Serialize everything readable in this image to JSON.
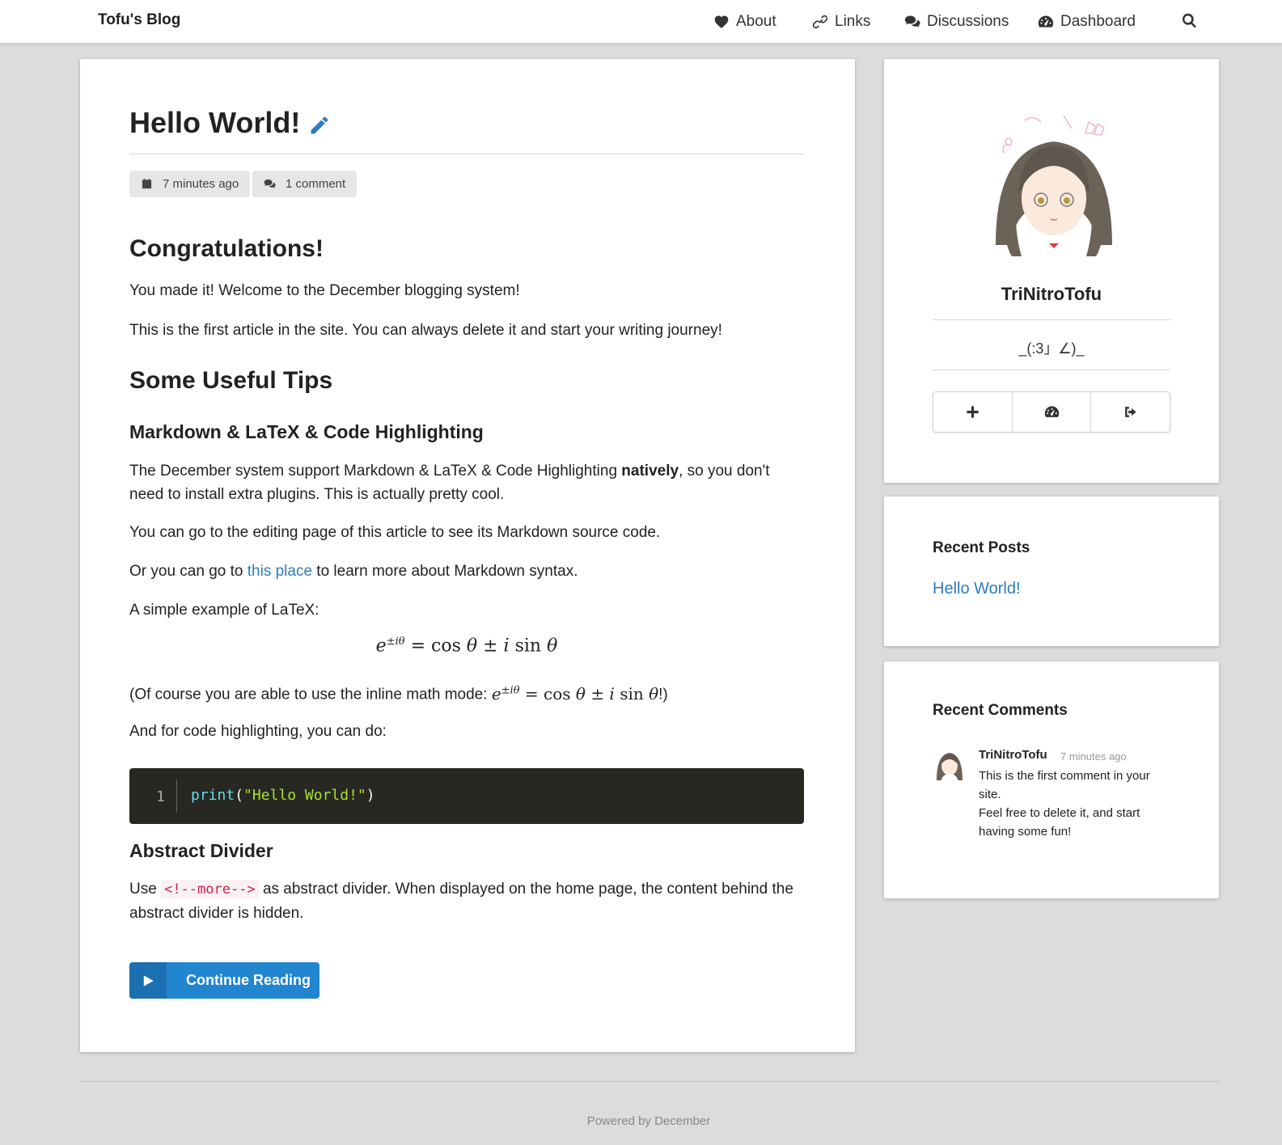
{
  "navbar": {
    "brand": "Tofu's Blog",
    "items": [
      {
        "label": "About",
        "icon": "heart-icon"
      },
      {
        "label": "Links",
        "icon": "link-icon"
      },
      {
        "label": "Discussions",
        "icon": "comments-icon"
      },
      {
        "label": "Dashboard",
        "icon": "dashboard-icon"
      }
    ],
    "search_icon": "search-icon"
  },
  "post": {
    "title": "Hello World!",
    "edit_icon": "pencil-icon",
    "meta": {
      "time": "7 minutes ago",
      "comments": "1 comment"
    },
    "h_congrats": "Congratulations!",
    "p_welcome": "You made it! Welcome to the December blogging system!",
    "p_first": "This is the first article in the site. You can always delete it and start your writing journey!",
    "h_tips": "Some Useful Tips",
    "h_markdown": "Markdown & LaTeX & Code Highlighting",
    "p_support_a": "The December system support Markdown & LaTeX & Code Highlighting ",
    "p_support_bold": "natively",
    "p_support_b": ", so you don't need to install extra plugins. This is actually pretty cool.",
    "p_editing": "You can go to the editing page of this article to see its Markdown source code.",
    "p_learn_a": "Or you can go to ",
    "p_learn_link": "this place",
    "p_learn_b": " to learn more about Markdown syntax.",
    "p_latex": "A simple example of LaTeX:",
    "p_inline_a": "(Of course you are able to use the inline math mode: ",
    "p_inline_b": "!)",
    "p_code": "And for code highlighting, you can do:",
    "code": {
      "line_number": "1",
      "fn": "print",
      "open_paren": "(",
      "string": "\"Hello World!\"",
      "close_paren": ")"
    },
    "h_divider": "Abstract Divider",
    "p_divider_a": "Use ",
    "p_divider_code": "<!--more-->",
    "p_divider_b": " as abstract divider. When displayed on the home page, the content behind the abstract divider is hidden.",
    "continue_label": "Continue Reading"
  },
  "profile": {
    "name": "TriNitroTofu",
    "motto": "_(:3」∠)_",
    "buttons": [
      "plus-icon",
      "dashboard-icon",
      "sign-out-icon"
    ]
  },
  "recent_posts": {
    "heading": "Recent Posts",
    "items": [
      "Hello World!"
    ]
  },
  "recent_comments": {
    "heading": "Recent Comments",
    "items": [
      {
        "author": "TriNitroTofu",
        "time": "7 minutes ago",
        "line1": "This is the first comment in your site.",
        "line2": "Feel free to delete it, and start having some fun!"
      }
    ]
  },
  "footer": {
    "text": "Powered by December"
  },
  "colors": {
    "accent": "#2185d0",
    "link": "#2f7bbf",
    "page_bg": "#dcdcdc",
    "code_bg": "#272822"
  }
}
